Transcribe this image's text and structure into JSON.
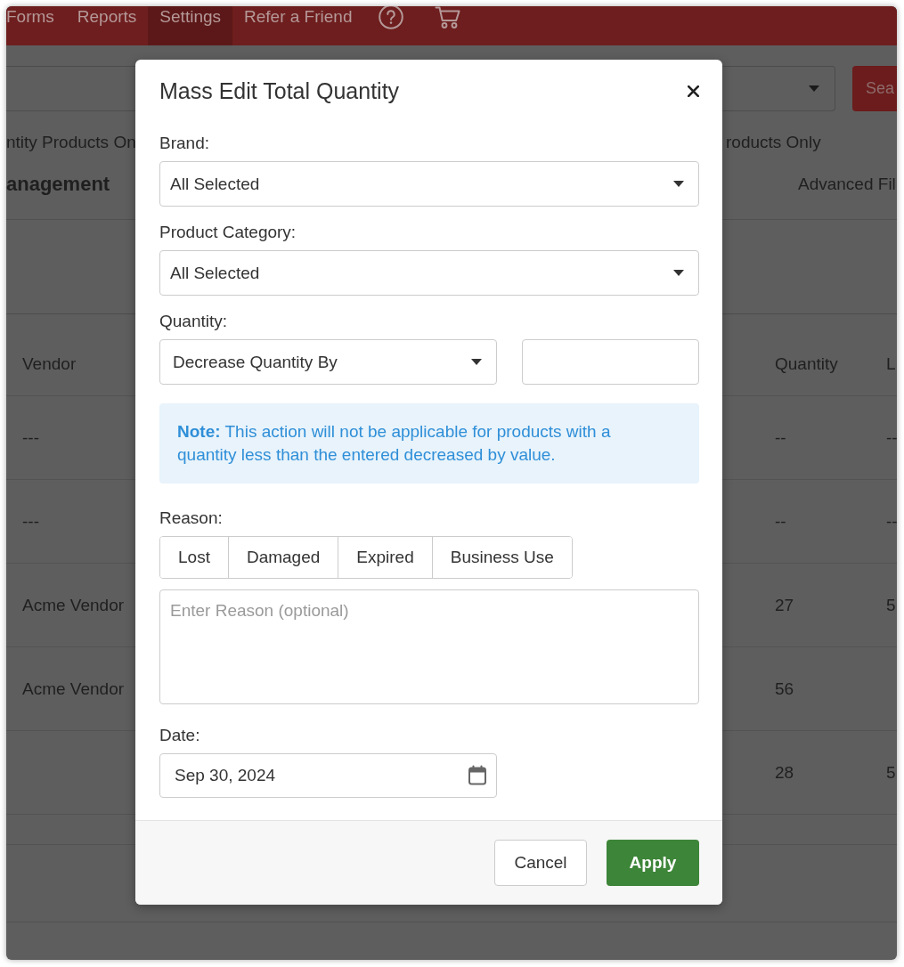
{
  "nav": {
    "items": [
      {
        "label": "Forms",
        "selected": false
      },
      {
        "label": "Reports",
        "selected": false
      },
      {
        "label": "Settings",
        "selected": true
      },
      {
        "label": "Refer a Friend",
        "selected": false
      }
    ]
  },
  "search": {
    "button": "Sea"
  },
  "filters": [
    "ntity Products On",
    "roducts Only"
  ],
  "page_title": "anagement",
  "advanced_filter": "Advanced Fil",
  "table": {
    "columns": {
      "vendor": "Vendor",
      "quantity": "Quantity",
      "column_3": "L"
    },
    "rows": [
      {
        "vendor": "---",
        "quantity": "--",
        "column_3": "--"
      },
      {
        "vendor": "---",
        "quantity": "--",
        "column_3": "--"
      },
      {
        "vendor": "Acme Vendor",
        "quantity": "27",
        "column_3": "5"
      },
      {
        "vendor": "Acme Vendor",
        "quantity": "56"
      },
      {
        "quantity": "28",
        "column_3": "5"
      }
    ]
  },
  "modal": {
    "title": "Mass Edit Total Quantity",
    "fields": [
      {
        "kind": "select",
        "label": "Brand:",
        "value": "All Selected"
      },
      {
        "kind": "select",
        "label": "Product Category:",
        "value": "All Selected"
      }
    ],
    "quantity": {
      "label": "Quantity:",
      "mode": "Decrease Quantity By"
    },
    "note": "**Note:** This action will not be applicable for products with a quantity less than the entered decreased by value.",
    "reason": {
      "label": "Reason:",
      "options": [
        {
          "label": "Lost",
          "selected": false
        },
        {
          "label": "Damaged",
          "selected": false
        },
        {
          "label": "Expired",
          "selected": false
        },
        {
          "label": "Business Use",
          "selected": false
        }
      ],
      "placeholder": "Enter Reason (optional)"
    },
    "date": {
      "label": "Date:",
      "value": "Sep 30, 2024"
    },
    "buttons": [
      {
        "kind": "secondary",
        "label": "Cancel"
      },
      {
        "kind": "primary",
        "label": "Apply"
      }
    ]
  }
}
